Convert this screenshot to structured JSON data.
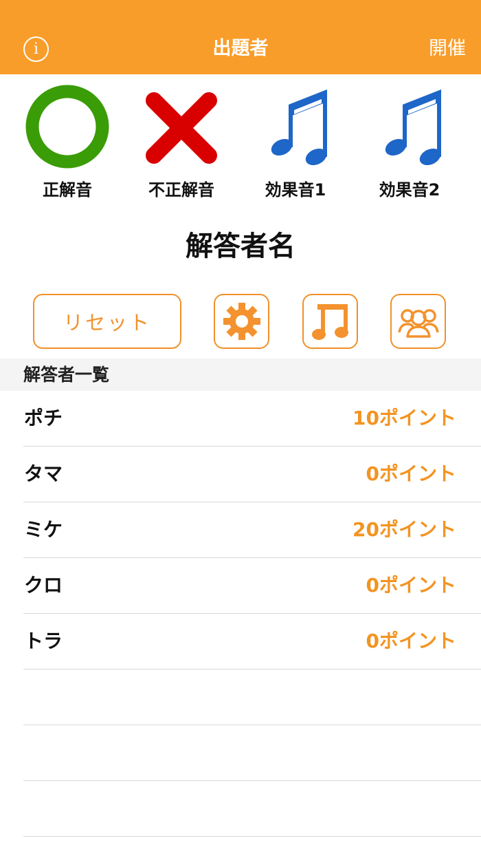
{
  "navbar": {
    "info_icon": "info-icon",
    "title": "出題者",
    "right_action": "開催"
  },
  "sound_buttons": [
    {
      "label": "正解音",
      "icon": "circle-correct-icon",
      "color": "#3a9c06"
    },
    {
      "label": "不正解音",
      "icon": "cross-wrong-icon",
      "color": "#d90000"
    },
    {
      "label": "効果音1",
      "icon": "music-note-icon",
      "color": "#1e66c8"
    },
    {
      "label": "効果音2",
      "icon": "music-note-icon",
      "color": "#1e66c8"
    }
  ],
  "answerer_name": "解答者名",
  "toolbar": {
    "reset_label": "リセット",
    "settings_icon": "gear-icon",
    "music_icon": "music-note-icon",
    "group_icon": "group-icon"
  },
  "list": {
    "section_title": "解答者一覧",
    "items": [
      {
        "name": "ポチ",
        "points": "10ポイント"
      },
      {
        "name": "タマ",
        "points": "0ポイント"
      },
      {
        "name": "ミケ",
        "points": "20ポイント"
      },
      {
        "name": "クロ",
        "points": "0ポイント"
      },
      {
        "name": "トラ",
        "points": "0ポイント"
      }
    ]
  },
  "colors": {
    "accent": "#f99d2a",
    "points": "#f39422",
    "correct": "#3a9c06",
    "wrong": "#d90000",
    "note": "#1e66c8"
  }
}
